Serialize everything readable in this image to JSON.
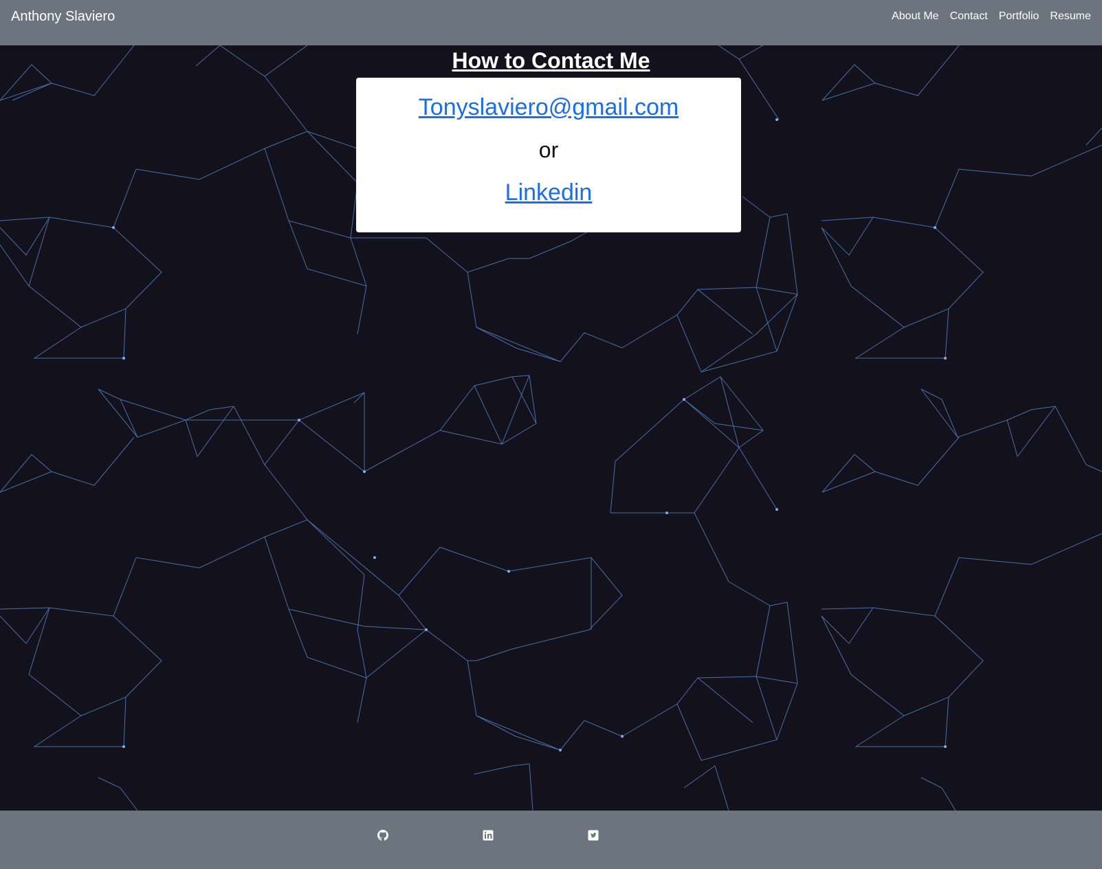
{
  "navbar": {
    "brand": "Anthony Slaviero",
    "links": [
      "About Me",
      "Contact",
      "Portfolio",
      "Resume"
    ]
  },
  "main": {
    "heading": "How to Contact Me",
    "email": "Tonyslaviero@gmail.com",
    "separator": "or",
    "linkedin": "Linkedin"
  },
  "footer": {
    "icons": [
      "github-icon",
      "linkedin-icon",
      "twitter-icon"
    ]
  },
  "colors": {
    "navbar_bg": "#6c757d",
    "page_bg": "#13111c",
    "network_line": "#5b8fd6",
    "link": "#1a6ee8"
  }
}
